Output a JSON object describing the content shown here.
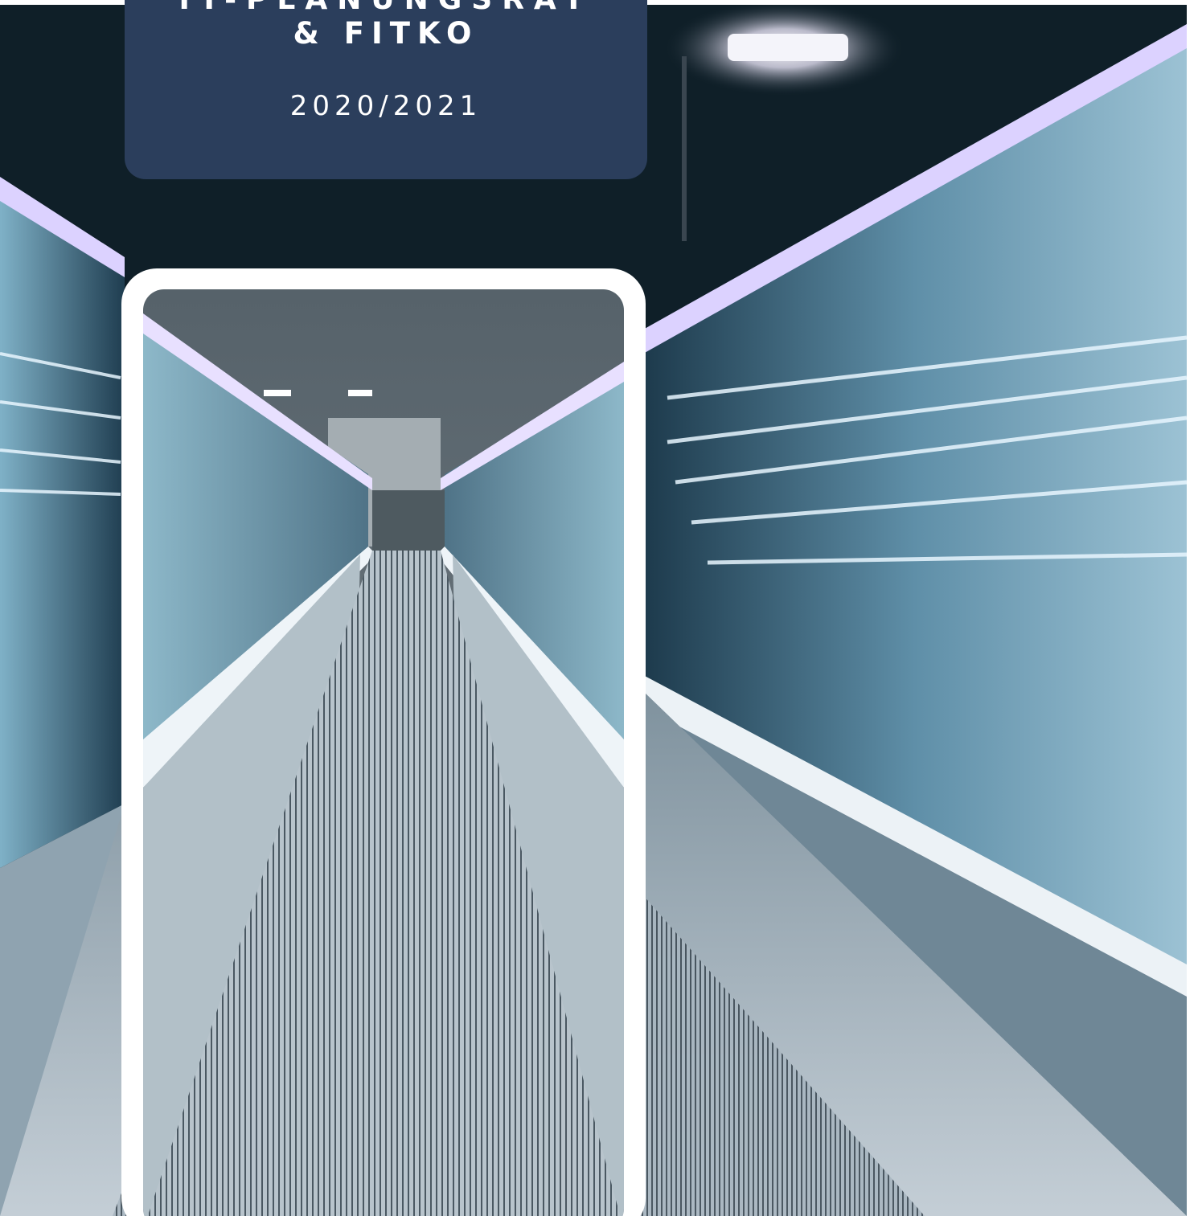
{
  "cover": {
    "title_line1": "IT-PLANUNGSRAT",
    "title_line2": "& FITKO",
    "period": "2020/2021"
  },
  "colors": {
    "title_box": "#2b3e5c",
    "night_sky": "#0f1f28",
    "light_glow": "#dcd2ff",
    "walkway": "#9fb0bb"
  },
  "imagery": {
    "background": "moving-walkway-photo",
    "inset": "moving-walkway-photo-inset"
  }
}
